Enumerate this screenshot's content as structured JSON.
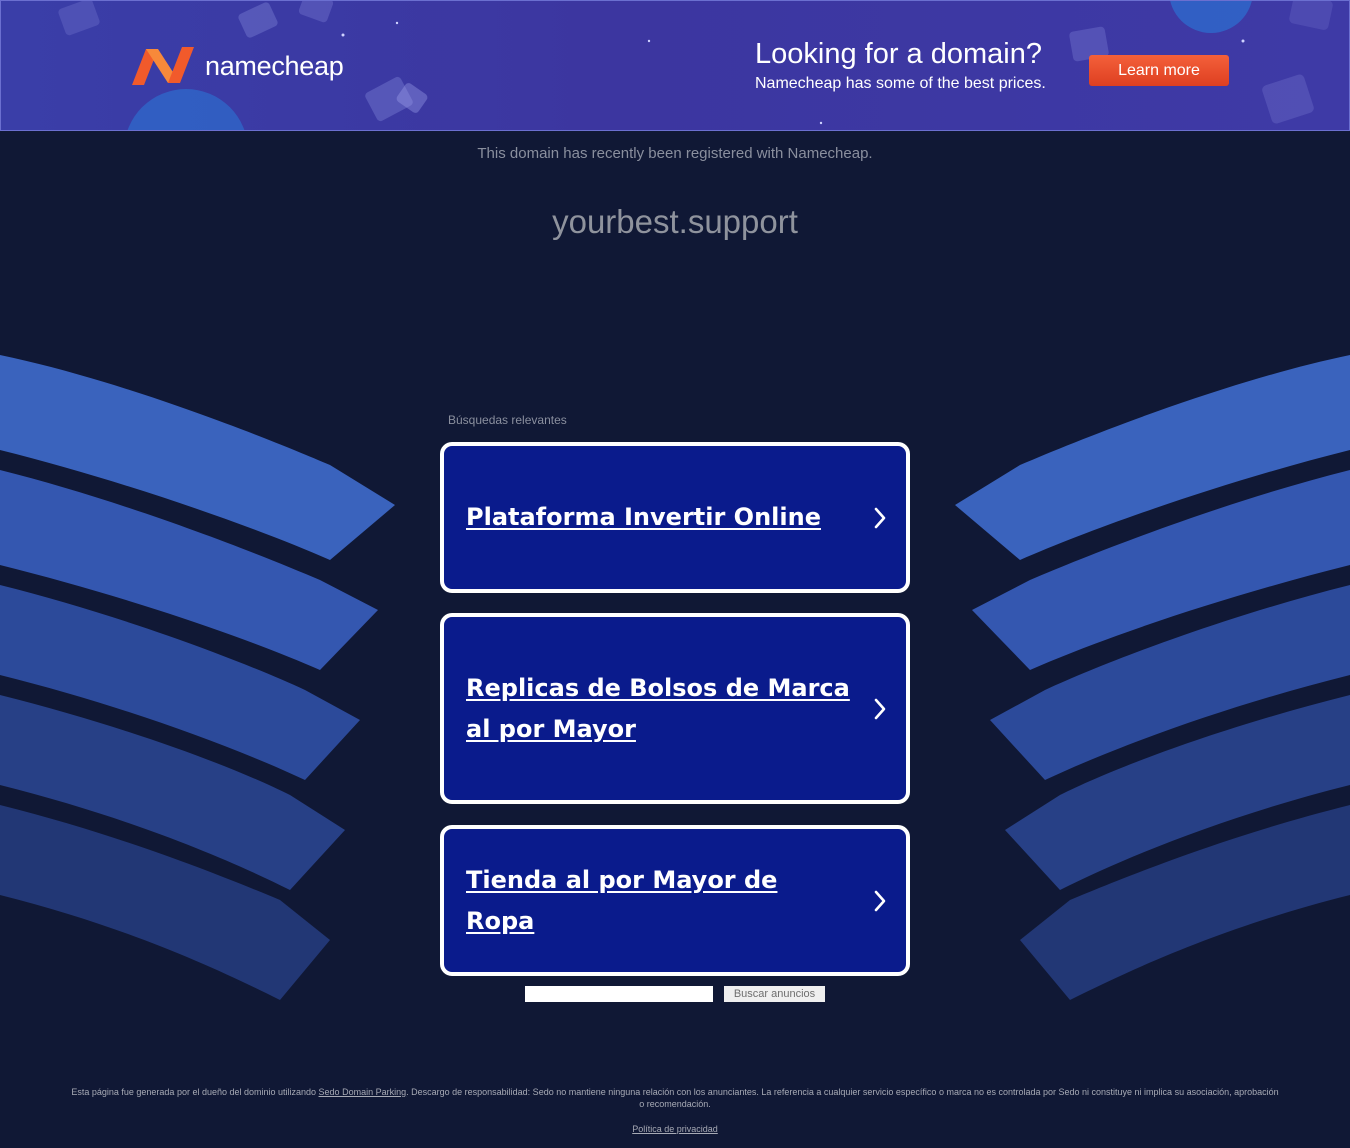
{
  "banner": {
    "logo_text": "namecheap",
    "headline": "Looking for a domain?",
    "subline": "Namecheap has some of the best prices.",
    "cta_label": "Learn more",
    "colors": {
      "brand_orange": "#f15a2b",
      "banner_bg": "#3c37a2",
      "cta": "#e9492a"
    }
  },
  "notice": "This domain has recently been registered with Namecheap.",
  "domain": "yourbest.support",
  "searches": {
    "heading": "Búsquedas relevantes",
    "items": [
      {
        "label": "Plataforma Invertir Online"
      },
      {
        "label": "Replicas de Bolsos de Marca al por Mayor"
      },
      {
        "label": "Tienda al por Mayor de Ropa"
      }
    ],
    "card_color": "#0a1b8c"
  },
  "ads_search": {
    "value": "",
    "button_label": "Buscar anuncios"
  },
  "footer": {
    "disclaimer_before": "Esta página fue generada por el dueño del dominio utilizando ",
    "disclaimer_link": "Sedo Domain Parking",
    "disclaimer_after": ". Descargo de responsabilidad: Sedo no mantiene ninguna relación con los anunciantes. La referencia a cualquier servicio específico o marca no es controlada por Sedo ni constituye ni implica su asociación, aprobación o recomendación.",
    "privacy_link": "Política de privacidad"
  }
}
